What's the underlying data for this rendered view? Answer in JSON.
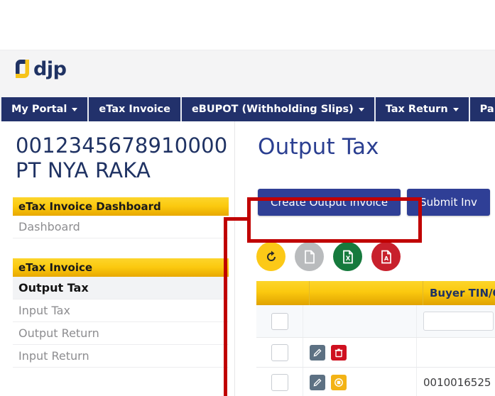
{
  "brand": {
    "logo_text": "djp",
    "logo_icon": "djp-square-logo"
  },
  "navbar": {
    "items": [
      {
        "label": "My Portal",
        "has_caret": true
      },
      {
        "label": "eTax Invoice",
        "has_caret": false
      },
      {
        "label": "eBUPOT (Withholding Slips)",
        "has_caret": true
      },
      {
        "label": "Tax Return",
        "has_caret": true
      },
      {
        "label": "Pa",
        "has_caret": false
      }
    ]
  },
  "sidebar": {
    "org_id": "0012345678910000",
    "org_name": "PT NYA RAKA",
    "blocks": [
      {
        "heading": "eTax Invoice Dashboard",
        "items": [
          {
            "label": "Dashboard",
            "active": false
          }
        ]
      },
      {
        "heading": "eTax Invoice",
        "items": [
          {
            "label": "Output Tax",
            "active": true
          },
          {
            "label": "Input Tax",
            "active": false
          },
          {
            "label": "Output Return",
            "active": false
          },
          {
            "label": "Input Return",
            "active": false
          }
        ]
      }
    ]
  },
  "main": {
    "page_title": "Output Tax",
    "buttons": [
      {
        "label": "Create Output Invoice",
        "highlighted": true
      },
      {
        "label": "Submit Inv",
        "highlighted": false
      }
    ],
    "toolbar_icons": [
      {
        "name": "refresh-icon",
        "color": "#fcc917"
      },
      {
        "name": "document-icon",
        "color": "#b9bbbd"
      },
      {
        "name": "excel-export-icon",
        "color": "#167a3d"
      },
      {
        "name": "pdf-export-icon",
        "color": "#c8202c"
      }
    ],
    "table": {
      "columns": [
        "",
        "",
        "Buyer TIN/Ot"
      ],
      "filter_row": {
        "checkbox": "unchecked",
        "buyer_tin_filter": ""
      },
      "rows": [
        {
          "checkbox": "unchecked",
          "actions": [
            "edit-icon",
            "delete-icon"
          ],
          "buyer_tin": ""
        },
        {
          "checkbox": "unchecked",
          "actions": [
            "edit-icon",
            "status-icon"
          ],
          "buyer_tin": "0010016525"
        }
      ]
    }
  },
  "annotation": {
    "color": "#c00000",
    "target": "Create Output Invoice"
  }
}
